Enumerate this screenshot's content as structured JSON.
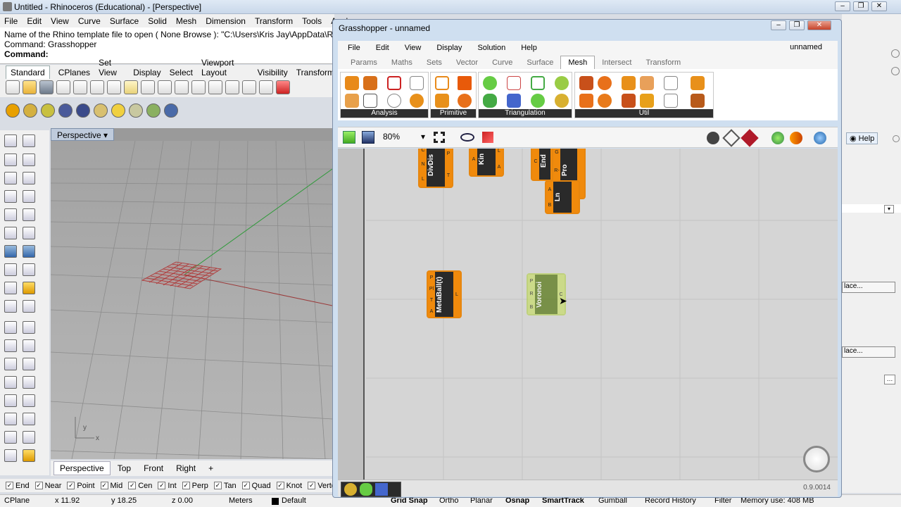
{
  "rhino": {
    "title": "Untitled - Rhinoceros (Educational) - [Perspective]",
    "menu": [
      "File",
      "Edit",
      "View",
      "Curve",
      "Surface",
      "Solid",
      "Mesh",
      "Dimension",
      "Transform",
      "Tools",
      "Analy"
    ],
    "command_lines": [
      "Name of the Rhino template file to open ( None  Browse ): \"C:\\Users\\Kris Jay\\AppData\\Roa",
      "Command: Grasshopper"
    ],
    "command_prompt": "Command:",
    "toolbar_tabs": [
      "Standard",
      "CPlanes",
      "Set View",
      "Display",
      "Select",
      "Viewport Layout",
      "Visibility",
      "Transform"
    ],
    "viewport_label": "Perspective",
    "viewport_tabs": [
      "Perspective",
      "Top",
      "Front",
      "Right"
    ],
    "axis_labels": {
      "y": "y",
      "x": "x"
    },
    "osnap": [
      "End",
      "Near",
      "Point",
      "Mid",
      "Cen",
      "Int",
      "Perp",
      "Tan",
      "Quad",
      "Knot",
      "Verte"
    ],
    "status": {
      "cplane": "CPlane",
      "x": "x 11.92",
      "y": "y 18.25",
      "z": "z 0.00",
      "units": "Meters",
      "layer": "Default",
      "grid_snap": "Grid Snap",
      "ortho": "Ortho",
      "planar": "Planar",
      "osnap": "Osnap",
      "smarttrack": "SmartTrack",
      "gumball": "Gumball",
      "record_history": "Record History",
      "filter": "Filter",
      "memory": "Memory use: 408 MB"
    },
    "right_panel": {
      "help": "Help",
      "place1": "lace...",
      "place2": "lace..."
    }
  },
  "grasshopper": {
    "title": "Grasshopper - unnamed",
    "menu": [
      "File",
      "Edit",
      "View",
      "Display",
      "Solution",
      "Help"
    ],
    "doc_name": "unnamed",
    "tabs": [
      "Params",
      "Maths",
      "Sets",
      "Vector",
      "Curve",
      "Surface",
      "Mesh",
      "Intersect",
      "Transform"
    ],
    "active_tab": "Mesh",
    "ribbon_groups": [
      "Analysis",
      "Primitive",
      "Triangulation",
      "Util"
    ],
    "zoom": "80%",
    "version": "0.9.0014",
    "components": [
      {
        "name": "DivDis",
        "inputs": [
          "C",
          "N",
          "L"
        ],
        "outputs": [
          "P",
          "T"
        ]
      },
      {
        "name": "Kin",
        "inputs": [
          "A"
        ],
        "outputs": [
          "L",
          "A"
        ]
      },
      {
        "name": "End",
        "inputs": [
          "C"
        ],
        "outputs": []
      },
      {
        "name": "Pro",
        "inputs": [
          "G",
          "R-",
          "R+"
        ],
        "outputs": [
          "T"
        ]
      },
      {
        "name": "Ln",
        "inputs": [
          "A",
          "B"
        ],
        "outputs": []
      },
      {
        "name": "MetaBall(t)",
        "inputs": [
          "P",
          "Pl",
          "T",
          "A"
        ],
        "outputs": [
          "L"
        ]
      },
      {
        "name": "Voronoi",
        "inputs": [
          "P",
          "R",
          "B"
        ],
        "outputs": [
          "C"
        ]
      }
    ]
  }
}
